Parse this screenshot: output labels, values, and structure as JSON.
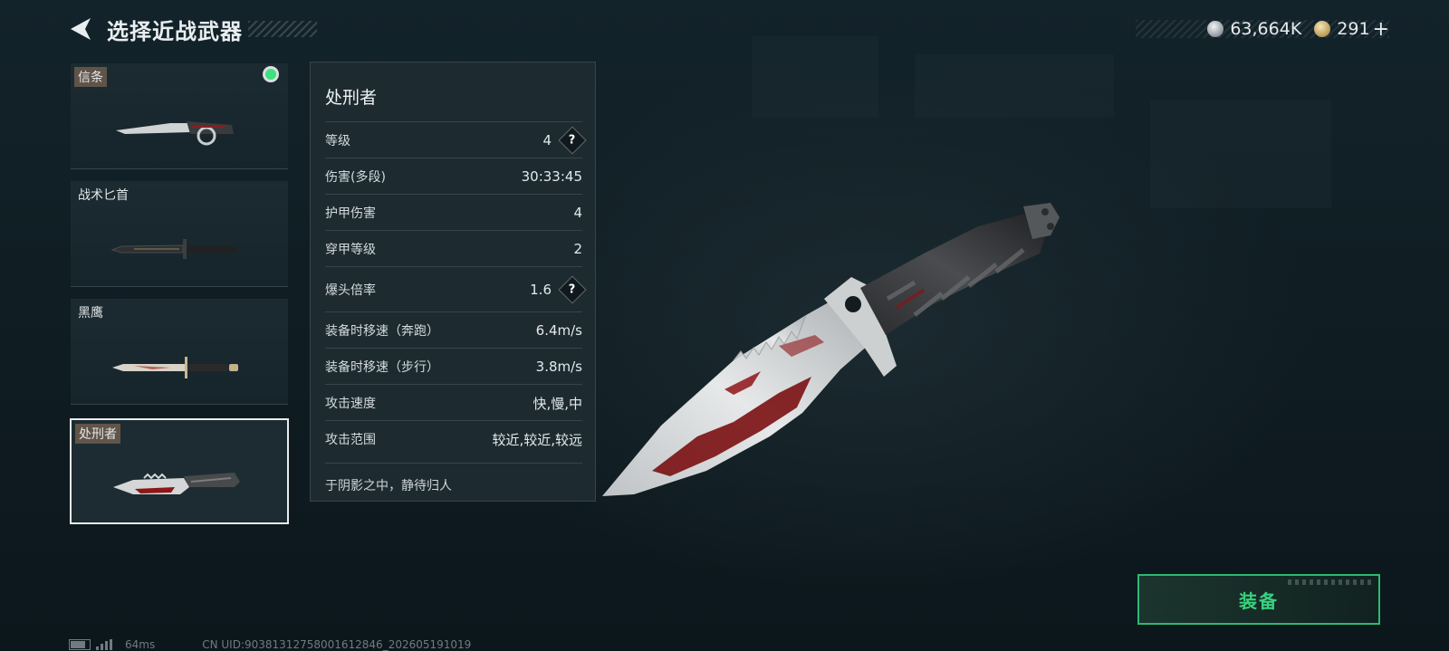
{
  "header": {
    "title": "选择近战武器",
    "back_icon": "back-arrow-icon"
  },
  "currency": {
    "silver": {
      "icon": "silver-coin-icon",
      "value": "63,664K"
    },
    "gold": {
      "icon": "gold-coin-icon",
      "value": "291",
      "plus": "+"
    }
  },
  "weapons": [
    {
      "name": "信条",
      "tagged": true,
      "equipped": true,
      "selected": false
    },
    {
      "name": "战术匕首",
      "tagged": false,
      "equipped": false,
      "selected": false
    },
    {
      "name": "黑鹰",
      "tagged": false,
      "equipped": false,
      "selected": false
    },
    {
      "name": "处刑者",
      "tagged": true,
      "equipped": false,
      "selected": true
    }
  ],
  "stats": {
    "title": "处刑者",
    "rows": [
      {
        "label": "等级",
        "value": "4",
        "help": true
      },
      {
        "label": "伤害(多段)",
        "value": "30:33:45",
        "help": false
      },
      {
        "label": "护甲伤害",
        "value": "4",
        "help": false
      },
      {
        "label": "穿甲等级",
        "value": "2",
        "help": false
      },
      {
        "label": "爆头倍率",
        "value": "1.6",
        "help": true
      },
      {
        "label": "装备时移速（奔跑）",
        "value": "6.4m/s",
        "help": false
      },
      {
        "label": "装备时移速（步行）",
        "value": "3.8m/s",
        "help": false
      },
      {
        "label": "攻击速度",
        "value": "快,慢,中",
        "help": false
      },
      {
        "label": "攻击范围",
        "value": "较近,较近,较远",
        "help": false
      }
    ],
    "help_symbol": "?",
    "description": "于阴影之中，静待归人"
  },
  "equip_button": {
    "label": "装备",
    "color": "#38d27f"
  },
  "footer": {
    "ping": "64ms",
    "uid": "CN UID:9038131275800161284​6_202605191019"
  },
  "colors": {
    "equipped": "#3ee07f",
    "accent": "#38d27f",
    "background": "#0f1b20"
  }
}
